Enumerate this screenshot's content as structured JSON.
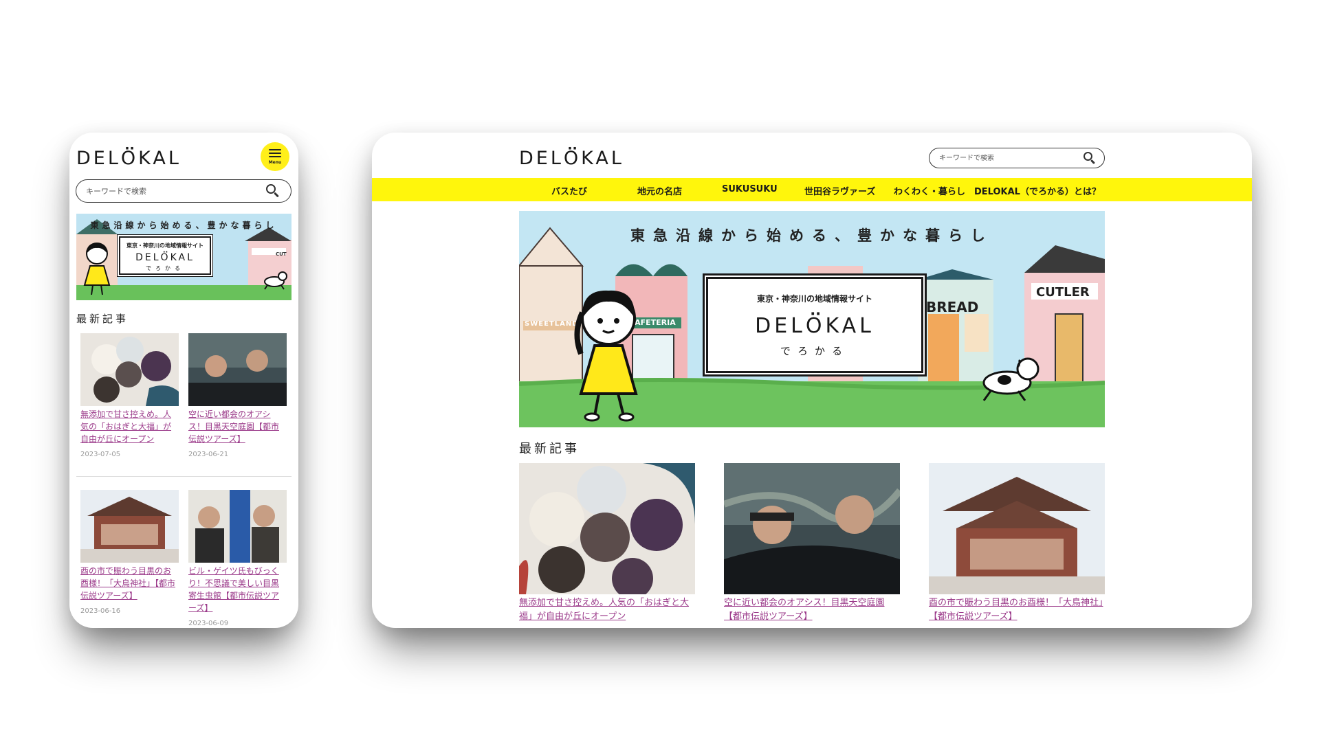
{
  "site": {
    "logo": "DELÖKAL",
    "logo_parts": [
      "DEL",
      "O",
      "KAL"
    ]
  },
  "search": {
    "placeholder": "キーワードで検索"
  },
  "menu": {
    "label": "Menu"
  },
  "nav": {
    "items": [
      {
        "label": "バスたび"
      },
      {
        "label": "地元の名店"
      },
      {
        "label": "SUKUSUKU"
      },
      {
        "label": "世田谷ラヴァーズ"
      },
      {
        "label": "わくわく・暮らし"
      },
      {
        "label": "DELOKAL（でろかる）とは？"
      }
    ]
  },
  "hero": {
    "tagline": "東急沿線から始める、豊かな暮らし",
    "card_sub": "東京・神奈川の地域情報サイト",
    "card_logo_parts": [
      "DEL",
      "O",
      "KAL"
    ],
    "card_kana": "でろかる",
    "shop_signs": [
      "SWEETLAND",
      "CAFETERIA",
      "BREAD",
      "CUTLER",
      "CUT"
    ]
  },
  "latest": {
    "title": "最新記事",
    "articles": [
      {
        "title": "無添加で甘さ控えめ。人気の「おはぎと大福」が自由が丘にオープン",
        "date": "2023-07-05",
        "image": "ohagi-photo"
      },
      {
        "title": "空に近い都会のオアシス！目黒天空庭園【都市伝説ツアーズ】",
        "date": "2023-06-21",
        "image": "sky-garden-photo"
      },
      {
        "title": "酉の市で賑わう目黒のお酉様！「大鳥神社」【都市伝説ツアーズ】",
        "date": "2023-06-16",
        "image": "shrine-photo"
      },
      {
        "title": "ビル・ゲイツ氏もびっくり！不思議で美しい目黒寄生虫館【都市伝説ツアーズ】",
        "date": "2023-06-09",
        "image": "museum-photo"
      }
    ]
  },
  "colors": {
    "accent_yellow": "#fff60c",
    "link_purple": "#9b3a8a",
    "date_gray": "#9a9a9a",
    "menu_yellow": "#ffef1a"
  },
  "icons": [
    "search-icon",
    "hamburger-icon"
  ]
}
